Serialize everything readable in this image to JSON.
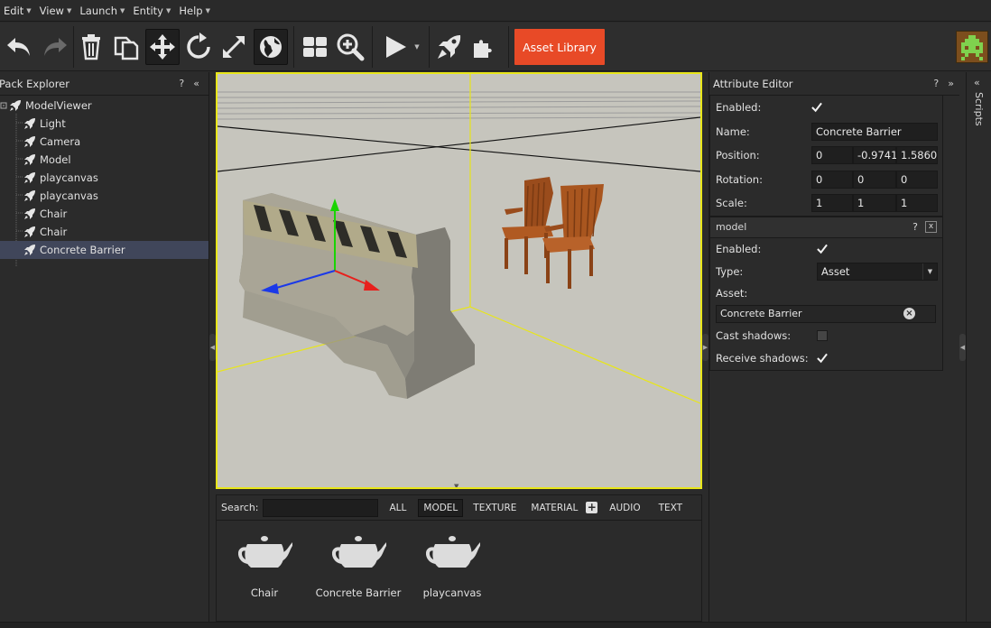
{
  "menu": {
    "items": [
      {
        "label": "Edit"
      },
      {
        "label": "View"
      },
      {
        "label": "Launch"
      },
      {
        "label": "Entity"
      },
      {
        "label": "Help"
      }
    ]
  },
  "toolbar": {
    "asset_library_label": "Asset Library"
  },
  "pack_explorer": {
    "title": "Pack Explorer",
    "help": "?",
    "collapse": "«",
    "root": "ModelViewer",
    "items": [
      {
        "label": "Light"
      },
      {
        "label": "Camera"
      },
      {
        "label": "Model"
      },
      {
        "label": "playcanvas"
      },
      {
        "label": "playcanvas"
      },
      {
        "label": "Chair"
      },
      {
        "label": "Chair"
      },
      {
        "label": "Concrete Barrier",
        "selected": true
      }
    ]
  },
  "attribute_editor": {
    "title": "Attribute Editor",
    "help": "?",
    "collapse": "»",
    "entity": {
      "enabled_label": "Enabled:",
      "enabled": true,
      "name_label": "Name:",
      "name_value": "Concrete Barrier",
      "position_label": "Position:",
      "position": [
        "0",
        "-0.9741",
        "1.5860"
      ],
      "rotation_label": "Rotation:",
      "rotation": [
        "0",
        "0",
        "0"
      ],
      "scale_label": "Scale:",
      "scale": [
        "1",
        "1",
        "1"
      ]
    },
    "model_component": {
      "title": "model",
      "help": "?",
      "close": "x",
      "enabled_label": "Enabled:",
      "enabled": true,
      "type_label": "Type:",
      "type_value": "Asset",
      "asset_label": "Asset:",
      "asset_value": "Concrete Barrier",
      "cast_shadows_label": "Cast shadows:",
      "cast_shadows": false,
      "receive_shadows_label": "Receive shadows:",
      "receive_shadows": true
    }
  },
  "scripts_panel": {
    "label": "Scripts",
    "collapse": "«"
  },
  "assets": {
    "search_label": "Search:",
    "search_value": "",
    "filters": [
      {
        "label": "ALL"
      },
      {
        "label": "MODEL",
        "active": true
      },
      {
        "label": "TEXTURE"
      },
      {
        "label": "MATERIAL"
      },
      {
        "label": "AUDIO"
      },
      {
        "label": "TEXT"
      }
    ],
    "items": [
      {
        "label": "Chair"
      },
      {
        "label": "Concrete Barrier"
      },
      {
        "label": "playcanvas"
      }
    ]
  },
  "colors": {
    "accent": "#e84a27",
    "viewport_border": "#e8e619",
    "selection": "#40465a"
  }
}
